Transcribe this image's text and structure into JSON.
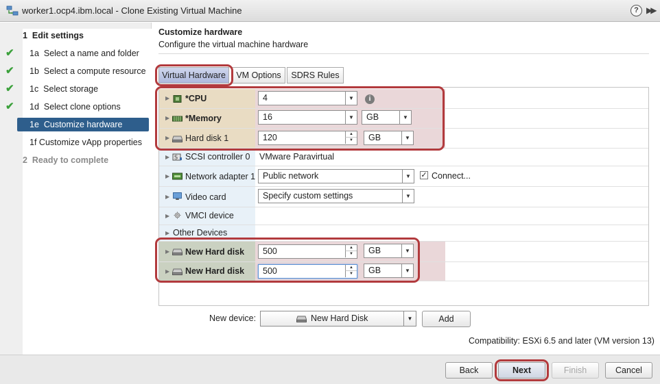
{
  "window": {
    "title": "worker1.ocp4.ibm.local - Clone Existing Virtual Machine",
    "help_label": "?",
    "expand_label": "▶▶"
  },
  "sidebar": {
    "steps": [
      {
        "num": "1",
        "label": "Edit settings",
        "state": "section"
      },
      {
        "num": "1a",
        "label": "Select a name and folder",
        "state": "done"
      },
      {
        "num": "1b",
        "label": "Select a compute resource",
        "state": "done"
      },
      {
        "num": "1c",
        "label": "Select storage",
        "state": "done"
      },
      {
        "num": "1d",
        "label": "Select clone options",
        "state": "done"
      },
      {
        "num": "1e",
        "label": "Customize hardware",
        "state": "active"
      },
      {
        "num": "1f",
        "label": "Customize vApp properties",
        "state": "pending"
      },
      {
        "num": "2",
        "label": "Ready to complete",
        "state": "disabled"
      }
    ],
    "check_glyph": "✔"
  },
  "main": {
    "heading": "Customize hardware",
    "subheading": "Configure the virtual machine hardware",
    "tabs": [
      {
        "label": "Virtual Hardware",
        "selected": true
      },
      {
        "label": "VM Options",
        "selected": false
      },
      {
        "label": "SDRS Rules",
        "selected": false
      }
    ]
  },
  "hardware": {
    "cpu": {
      "label": "*CPU",
      "value": "4"
    },
    "memory": {
      "label": "*Memory",
      "value": "16",
      "unit": "GB"
    },
    "hard_disk_1": {
      "label": "Hard disk 1",
      "value": "120",
      "unit": "GB"
    },
    "scsi": {
      "label": "SCSI controller 0",
      "value": "VMware Paravirtual"
    },
    "network": {
      "label": "Network adapter 1",
      "value": "Public network",
      "connect_label": "Connect...",
      "connect_checked": true
    },
    "video": {
      "label": "Video card",
      "value": "Specify custom settings"
    },
    "vmci": {
      "label": "VMCI device"
    },
    "other": {
      "label": "Other Devices"
    },
    "new_disk_1": {
      "label": "New Hard disk",
      "value": "500",
      "unit": "GB"
    },
    "new_disk_2": {
      "label": "New Hard disk",
      "value": "500",
      "unit": "GB"
    }
  },
  "new_device": {
    "label": "New device:",
    "selected": "New Hard Disk",
    "add_label": "Add"
  },
  "compatibility": "Compatibility: ESXi 6.5 and later (VM version 13)",
  "footer": {
    "back": "Back",
    "next": "Next",
    "finish": "Finish",
    "cancel": "Cancel"
  },
  "colors": {
    "accent_selected": "#2e5e8c",
    "annotation_red": "#b23a3d",
    "check_green": "#3ca13c"
  },
  "icons": [
    "vm-clone-icon",
    "help-icon",
    "expand-icon",
    "check-icon",
    "cpu-icon",
    "memory-icon",
    "hard-disk-icon",
    "scsi-controller-icon",
    "network-adapter-icon",
    "video-card-icon",
    "vmci-device-icon",
    "info-icon"
  ]
}
